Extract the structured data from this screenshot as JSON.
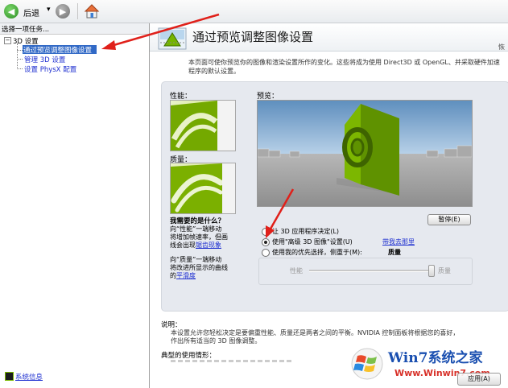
{
  "toolbar": {
    "back_label": "后退",
    "dropdown_glyph": "▾"
  },
  "left": {
    "header": "选择一项任务...",
    "tree_root": "3D 设置",
    "items": [
      {
        "label": "通过预览调整图像设置",
        "selected": true
      },
      {
        "label": "管理 3D 设置",
        "selected": false
      },
      {
        "label": "设置 PhysX 配置",
        "selected": false
      }
    ],
    "system_info": "系统信息"
  },
  "right": {
    "title": "通过预览调整图像设置",
    "restore": "恢",
    "description_lines": [
      "本页面可使你预览你的图像和渲染设置所作的变化。这些将成为使用 Direct3D 或 OpenGL、并采取硬件加速",
      "程序的默认设置。"
    ],
    "performance_label": "性能：",
    "quality_label": "质量：",
    "preview_label": "预览：",
    "pause_button": "暂停(E)",
    "help_title": "我需要的是什么？",
    "help_perf_lines": [
      "向“性能”一端移动",
      "将增加帧速率，但画",
      "线会出现"
    ],
    "help_perf_link": "锯齿现象",
    "help_quality_lines": [
      "向“质量”一端移动",
      "将改进所显示的曲线",
      "的"
    ],
    "help_quality_link": "平滑度",
    "options": [
      {
        "label": "让 3D 应用程序决定(L)",
        "checked": false
      },
      {
        "label": "使用\"高级 3D 图像\"设置(U)",
        "checked": true
      },
      {
        "label": "使用我的优先选择，侧重于(M):",
        "checked": false
      }
    ],
    "advanced_link": "带我去那里",
    "slider_title": "质量",
    "slider_left": "性能",
    "slider_right": "质量",
    "slider_value": 1.0,
    "explain_title": "说明：",
    "explain_lines": [
      "本设置允许您轻松决定是要偏重性能、质量还是两者之间的平衡。NVIDIA 控制面板将根据您的喜好，",
      "作出所有适当的 3D 图像调整。"
    ],
    "typical_title": "典型的使用情形：",
    "apply_button": "应用(A)",
    "watermark_brand": "Win7系统之家",
    "watermark_url": "Www.Winwin7.com"
  }
}
